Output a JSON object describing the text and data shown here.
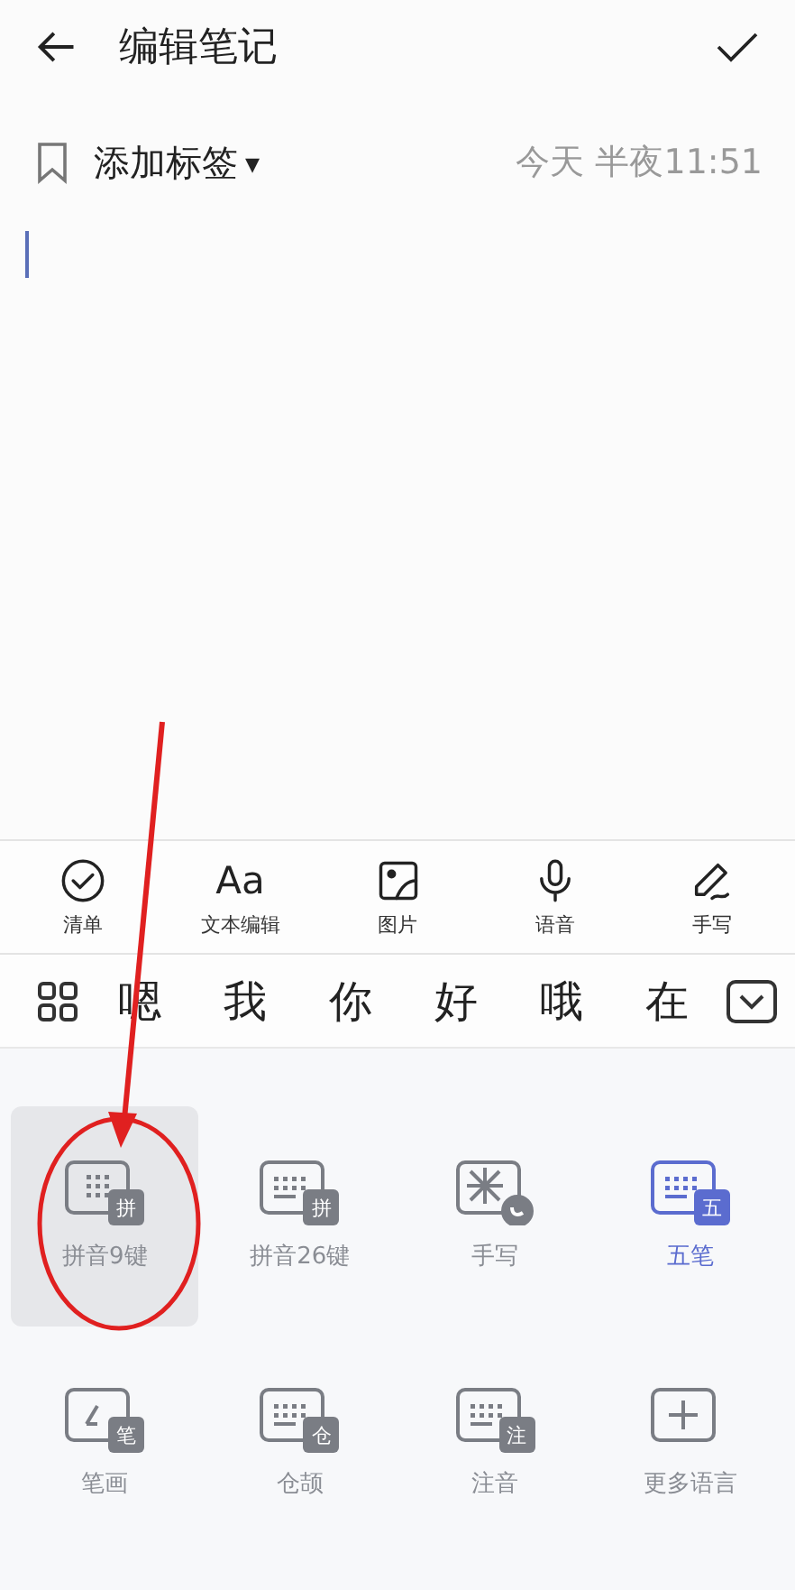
{
  "header": {
    "title": "编辑笔记"
  },
  "meta": {
    "tag_label": "添加标签",
    "caret": "▾",
    "timestamp": "今天 半夜11:51"
  },
  "editor": {
    "cursor": true
  },
  "toolbar": [
    {
      "kind": "check",
      "label": "清单"
    },
    {
      "kind": "text",
      "label": "文本编辑",
      "glyph": "Aa"
    },
    {
      "kind": "image",
      "label": "图片"
    },
    {
      "kind": "mic",
      "label": "语音"
    },
    {
      "kind": "pen",
      "label": "手写"
    }
  ],
  "candidates": [
    "嗯",
    "我",
    "你",
    "好",
    "哦",
    "在"
  ],
  "input_methods": [
    {
      "kind": "dots",
      "badge": "拼",
      "label": "拼音9键",
      "selected": true,
      "current": false
    },
    {
      "kind": "keys",
      "badge": "拼",
      "label": "拼音26键",
      "selected": false,
      "current": false
    },
    {
      "kind": "hand",
      "label": "手写",
      "selected": false,
      "current": false
    },
    {
      "kind": "keys",
      "badge": "五",
      "label": "五笔",
      "selected": false,
      "current": true
    },
    {
      "kind": "stroke",
      "badge": "笔",
      "label": "笔画",
      "selected": false,
      "current": false
    },
    {
      "kind": "keys",
      "badge": "仓",
      "label": "仓颉",
      "selected": false,
      "current": false
    },
    {
      "kind": "keys",
      "badge": "注",
      "label": "注音",
      "selected": false,
      "current": false
    },
    {
      "kind": "plus",
      "label": "更多语言",
      "selected": false,
      "current": false
    }
  ],
  "annotation": {
    "arrow": true,
    "ellipse": true
  }
}
